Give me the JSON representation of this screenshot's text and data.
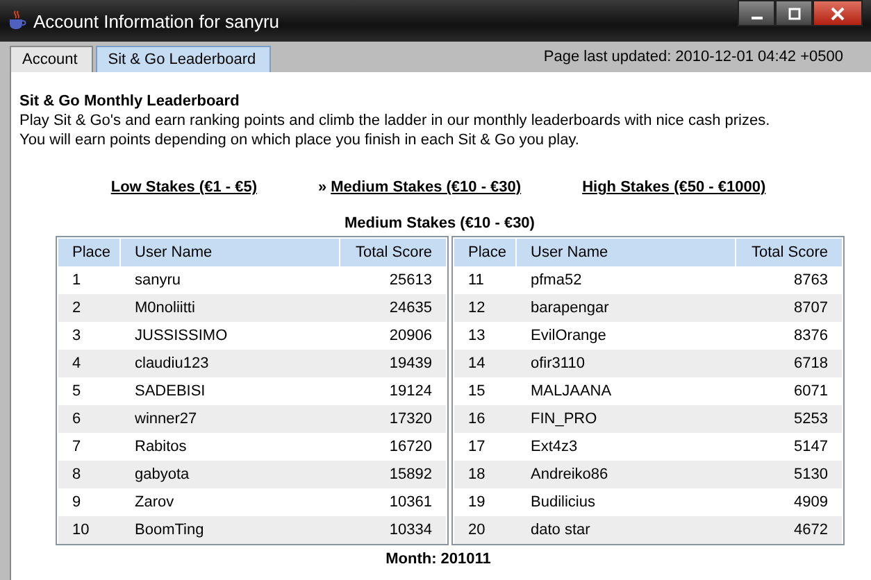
{
  "window": {
    "title": "Account Information for sanyru"
  },
  "tabs": [
    {
      "label": "Account",
      "selected": false
    },
    {
      "label": "Sit & Go Leaderboard",
      "selected": true
    }
  ],
  "last_updated": "Page last updated: 2010-12-01 04:42 +0500",
  "heading": "Sit & Go Monthly Leaderboard",
  "intro": [
    "Play Sit & Go's and earn ranking points and climb the ladder in our monthly leaderboards with nice cash prizes.",
    "You will earn points depending on which place you finish in each Sit & Go you play."
  ],
  "selected_marker": "»",
  "stakes": [
    {
      "label": "Low Stakes (€1 - €5)",
      "selected": false
    },
    {
      "label": "Medium Stakes (€10 - €30)",
      "selected": true
    },
    {
      "label": "High Stakes (€50 - €1000)",
      "selected": false
    }
  ],
  "table_title": "Medium Stakes (€10 - €30)",
  "tables": [
    {
      "columns": [
        "Place",
        "User Name",
        "Total Score"
      ],
      "rows": [
        [
          "1",
          "sanyru",
          "25613"
        ],
        [
          "2",
          "M0noliitti",
          "24635"
        ],
        [
          "3",
          "JUSSISSIMO",
          "20906"
        ],
        [
          "4",
          "claudiu123",
          "19439"
        ],
        [
          "5",
          "SADEBISI",
          "19124"
        ],
        [
          "6",
          "winner27",
          "17320"
        ],
        [
          "7",
          "Rabitos",
          "16720"
        ],
        [
          "8",
          "gabyota",
          "15892"
        ],
        [
          "9",
          "Zarov",
          "10361"
        ],
        [
          "10",
          "BoomTing",
          "10334"
        ]
      ]
    },
    {
      "columns": [
        "Place",
        "User Name",
        "Total Score"
      ],
      "rows": [
        [
          "11",
          "pfma52",
          "8763"
        ],
        [
          "12",
          "barapengar",
          "8707"
        ],
        [
          "13",
          "EvilOrange",
          "8376"
        ],
        [
          "14",
          "ofir3110",
          "6718"
        ],
        [
          "15",
          "MALJAANA",
          "6071"
        ],
        [
          "16",
          "FIN_PRO",
          "5253"
        ],
        [
          "17",
          "Ext4z3",
          "5147"
        ],
        [
          "18",
          "Andreiko86",
          "5130"
        ],
        [
          "19",
          "Budilicius",
          "4909"
        ],
        [
          "20",
          "dato star",
          "4672"
        ]
      ]
    }
  ],
  "month": "Month: 201011"
}
